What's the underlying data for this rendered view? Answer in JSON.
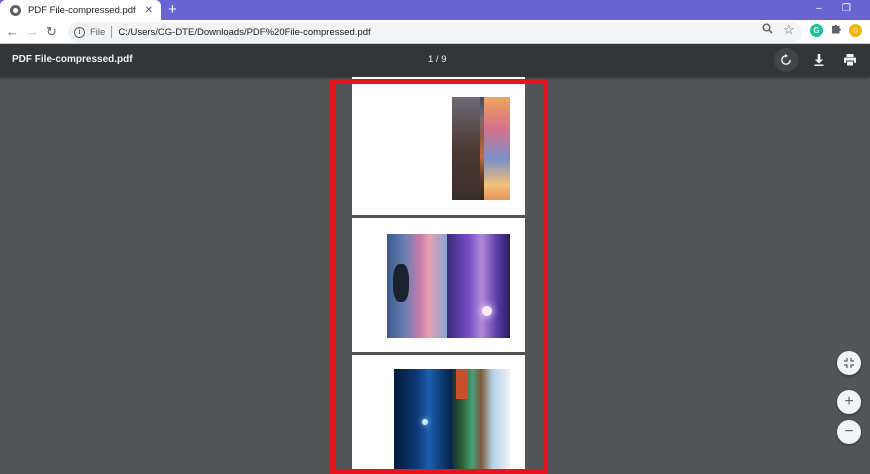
{
  "browser": {
    "tab_title": "PDF File-compressed.pdf",
    "tab_close": "✕",
    "new_tab": "+",
    "window_restore": "❐",
    "window_minimize": "–",
    "nav": {
      "back": "←",
      "forward": "→",
      "reload": "↻"
    },
    "address": {
      "scheme": "File",
      "url": "C:/Users/CG-DTE/Downloads/PDF%20File-compressed.pdf"
    },
    "icons": [
      "info-icon",
      "zoom-icon",
      "star-icon",
      "grammarly-icon",
      "extensions-icon",
      "profile-avatar"
    ]
  },
  "viewer": {
    "title": "PDF File-compressed.pdf",
    "page_indicator": "1 / 9",
    "current_page": 1,
    "total_pages": 9,
    "actions": [
      "rotate-icon",
      "download-icon",
      "print-icon"
    ],
    "zoom_controls": {
      "fit": "fit-page-icon",
      "zoom_in": "+",
      "zoom_out": "−"
    }
  },
  "colors": {
    "tabbar": "#6a63d4",
    "viewer_bg": "#525659",
    "toolbar_bg": "#323639",
    "highlight_border": "#e8141c",
    "grammarly": "#15c39a"
  }
}
